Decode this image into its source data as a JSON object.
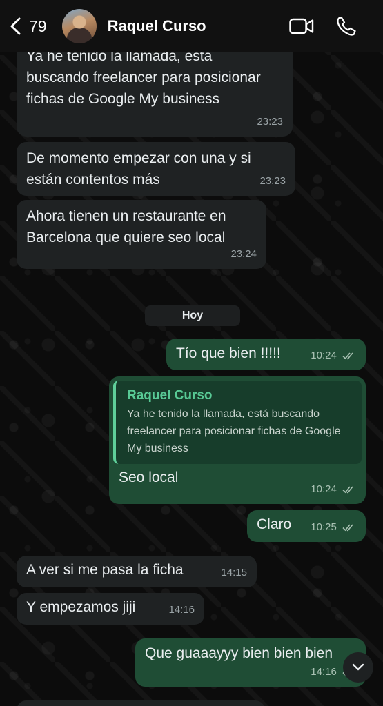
{
  "header": {
    "back_count": "79",
    "contact_name": "Raquel Curso"
  },
  "day_divider": "Hoy",
  "messages": [
    {
      "direction": "in",
      "text": "Ya he tenido la llamada, está buscando freelancer para posicionar fichas de Google My business",
      "time": "23:23"
    },
    {
      "direction": "in",
      "text": "De momento empezar con una y si están contentos más",
      "time": "23:23"
    },
    {
      "direction": "in",
      "text": "Ahora tienen un restaurante en Barcelona que quiere seo local",
      "time": "23:24"
    },
    {
      "direction": "out",
      "text": "Tío que bien !!!!!",
      "time": "10:24",
      "status": "read"
    },
    {
      "direction": "out",
      "quote": {
        "author": "Raquel Curso",
        "text": "Ya he tenido la llamada, está buscando freelancer para posicionar fichas de Google My business"
      },
      "text": "Seo local",
      "time": "10:24",
      "status": "read"
    },
    {
      "direction": "out",
      "text": "Claro",
      "time": "10:25",
      "status": "read"
    },
    {
      "direction": "in",
      "text": "A ver si me pasa la ficha",
      "time": "14:15"
    },
    {
      "direction": "in",
      "text": "Y empezamos jiji",
      "time": "14:16"
    },
    {
      "direction": "out",
      "text": "Que guaaayyy bien bien bien",
      "time": "14:16",
      "status": "read"
    }
  ],
  "icons": {
    "back": "chevron-left-icon",
    "video": "video-camera-icon",
    "call": "phone-icon",
    "scroll": "chevron-down-icon",
    "read": "double-check-icon"
  },
  "colors": {
    "incoming_bubble": "#1f2223",
    "outgoing_bubble": "#1f4d35",
    "quote_accent": "#58c995"
  }
}
